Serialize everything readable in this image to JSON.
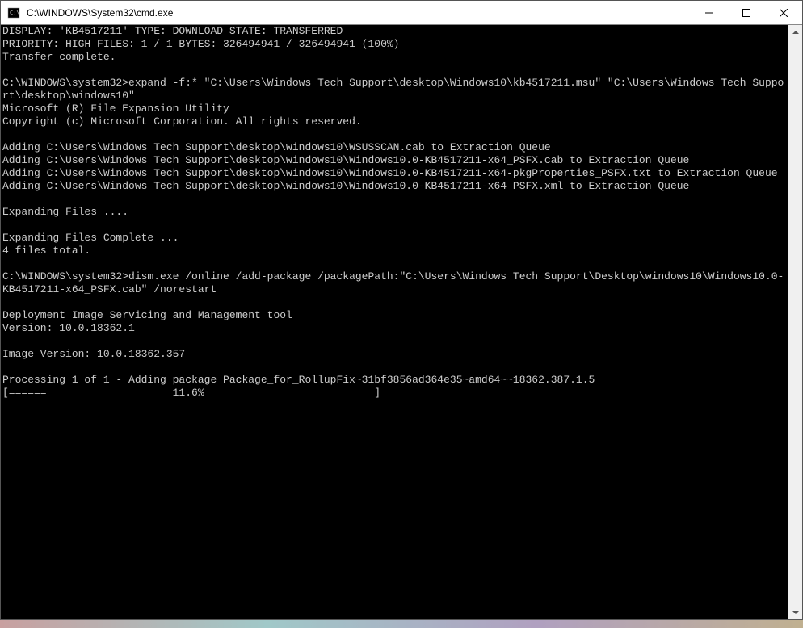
{
  "window": {
    "title": "C:\\WINDOWS\\System32\\cmd.exe"
  },
  "terminal": {
    "lines": [
      "DISPLAY: 'KB4517211' TYPE: DOWNLOAD STATE: TRANSFERRED",
      "PRIORITY: HIGH FILES: 1 / 1 BYTES: 326494941 / 326494941 (100%)",
      "Transfer complete.",
      "",
      "C:\\WINDOWS\\system32>expand -f:* \"C:\\Users\\Windows Tech Support\\desktop\\Windows10\\kb4517211.msu\" \"C:\\Users\\Windows Tech Support\\desktop\\windows10\"",
      "Microsoft (R) File Expansion Utility",
      "Copyright (c) Microsoft Corporation. All rights reserved.",
      "",
      "Adding C:\\Users\\Windows Tech Support\\desktop\\windows10\\WSUSSCAN.cab to Extraction Queue",
      "Adding C:\\Users\\Windows Tech Support\\desktop\\windows10\\Windows10.0-KB4517211-x64_PSFX.cab to Extraction Queue",
      "Adding C:\\Users\\Windows Tech Support\\desktop\\windows10\\Windows10.0-KB4517211-x64-pkgProperties_PSFX.txt to Extraction Queue",
      "Adding C:\\Users\\Windows Tech Support\\desktop\\windows10\\Windows10.0-KB4517211-x64_PSFX.xml to Extraction Queue",
      "",
      "Expanding Files ....",
      "",
      "Expanding Files Complete ...",
      "4 files total.",
      "",
      "C:\\WINDOWS\\system32>dism.exe /online /add-package /packagePath:\"C:\\Users\\Windows Tech Support\\Desktop\\windows10\\Windows10.0-KB4517211-x64_PSFX.cab\" /norestart",
      "",
      "Deployment Image Servicing and Management tool",
      "Version: 10.0.18362.1",
      "",
      "Image Version: 10.0.18362.357",
      "",
      "Processing 1 of 1 - Adding package Package_for_RollupFix~31bf3856ad364e35~amd64~~18362.387.1.5",
      "[======                    11.6%                           ]"
    ]
  }
}
